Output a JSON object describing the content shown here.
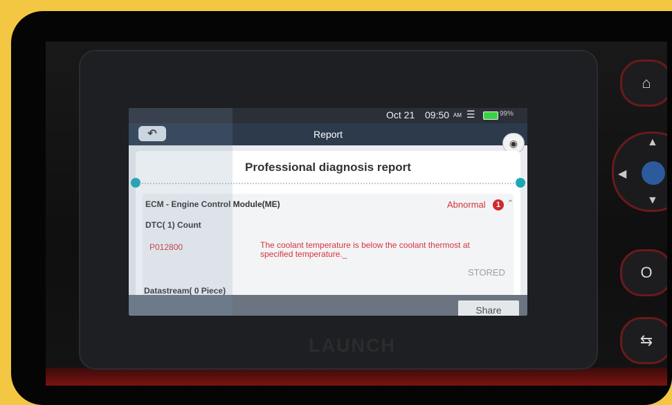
{
  "status_bar": {
    "date": "Oct 21",
    "time": "09:50",
    "ampm": "AM",
    "battery_label": "99%",
    "wifi_icon": "wifi-icon",
    "battery_icon": "battery-icon"
  },
  "title_bar": {
    "title": "Report",
    "back_icon": "back-arrow-icon"
  },
  "report": {
    "heading": "Professional diagnosis report",
    "module": {
      "name": "ECM - Engine Control Module(ME)",
      "status": "Abnormal",
      "abnormal_count": "1",
      "dtc_count_label": "DTC( 1) Count",
      "dtc": {
        "code": "P012800",
        "description": "The coolant temperature is below the coolant thermost at specified temperature._",
        "status": "STORED"
      },
      "datastream_label": "Datastream( 0 Piece)"
    }
  },
  "actions": {
    "share": "Share"
  },
  "device": {
    "brand": "LAUNCH"
  },
  "colors": {
    "frame_yellow": "#f4c742",
    "error_red": "#d5343b",
    "title_bar": "#2c3a4c",
    "accent_teal": "#1aa7b6"
  }
}
